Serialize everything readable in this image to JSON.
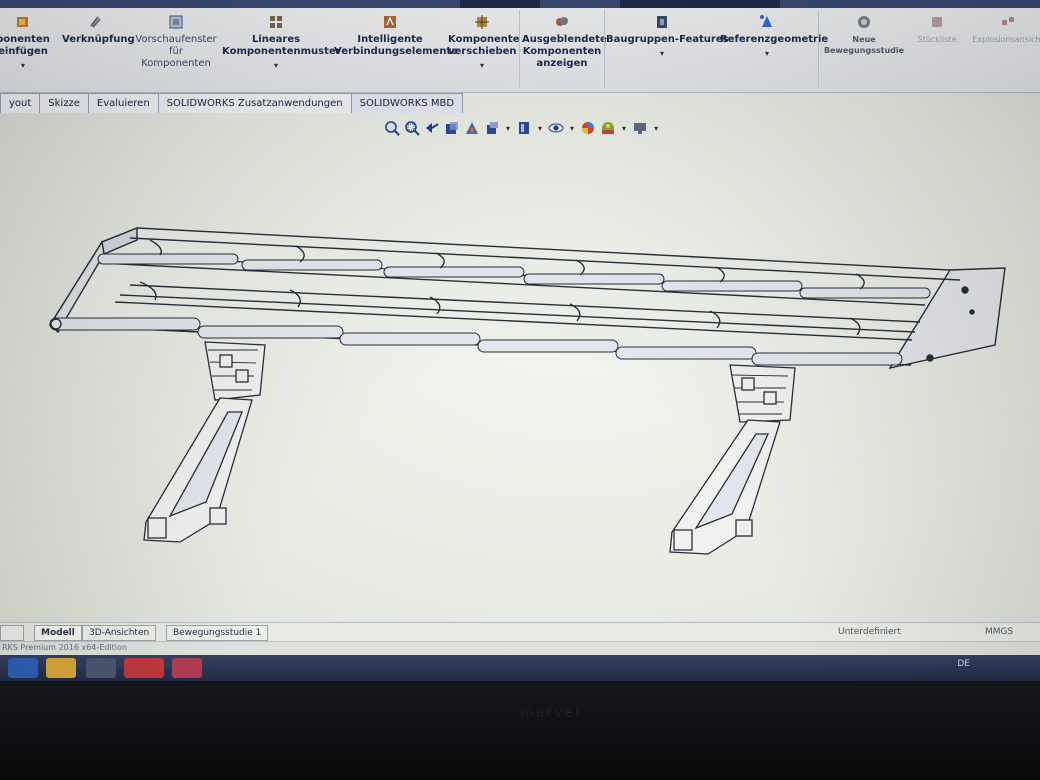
{
  "ribbon": {
    "buttons": [
      {
        "label": "ponenten\neinfügen",
        "icon": "insert-components-icon"
      },
      {
        "label": "Verknüpfung",
        "icon": "mate-icon"
      },
      {
        "label": "Vorschaufenster\nfür\nKomponenten",
        "icon": "preview-window-icon"
      },
      {
        "label": "Lineares\nKomponentenmuster",
        "icon": "linear-pattern-icon"
      },
      {
        "label": "Intelligente\nVerbindungselemente",
        "icon": "smart-fasteners-icon"
      },
      {
        "label": "Komponente\nverschieben",
        "icon": "move-component-icon"
      },
      {
        "label": "Ausgeblendete\nKomponenten\nanzeigen",
        "icon": "show-hidden-icon"
      },
      {
        "label": "Baugruppen-Features",
        "icon": "assembly-features-icon"
      },
      {
        "label": "Referenzgeometrie",
        "icon": "reference-geometry-icon"
      },
      {
        "label": "Neue\nBewegungsstudie",
        "icon": "motion-study-icon"
      },
      {
        "label": "Stückliste",
        "icon": "bom-icon"
      },
      {
        "label": "Explosionsansicht",
        "icon": "exploded-view-icon"
      }
    ]
  },
  "command_tabs": [
    "yout",
    "Skizze",
    "Evaluieren",
    "SOLIDWORKS Zusatzanwendungen",
    "SOLIDWORKS MBD"
  ],
  "bottom_tabs": [
    "Modell",
    "3D-Ansichten",
    "Bewegungsstudie 1"
  ],
  "status": {
    "state": "Unterdefiniert",
    "units": "MMGS",
    "edition": "RKS Premium 2016 x64-Edition",
    "language": "DE"
  },
  "bezel_brand": "marvel",
  "colors": {
    "ribbon_text": "#1b2b56",
    "taskbar": "#2b3452",
    "canvas": "#eceee6",
    "line": "#2a2e3a"
  }
}
